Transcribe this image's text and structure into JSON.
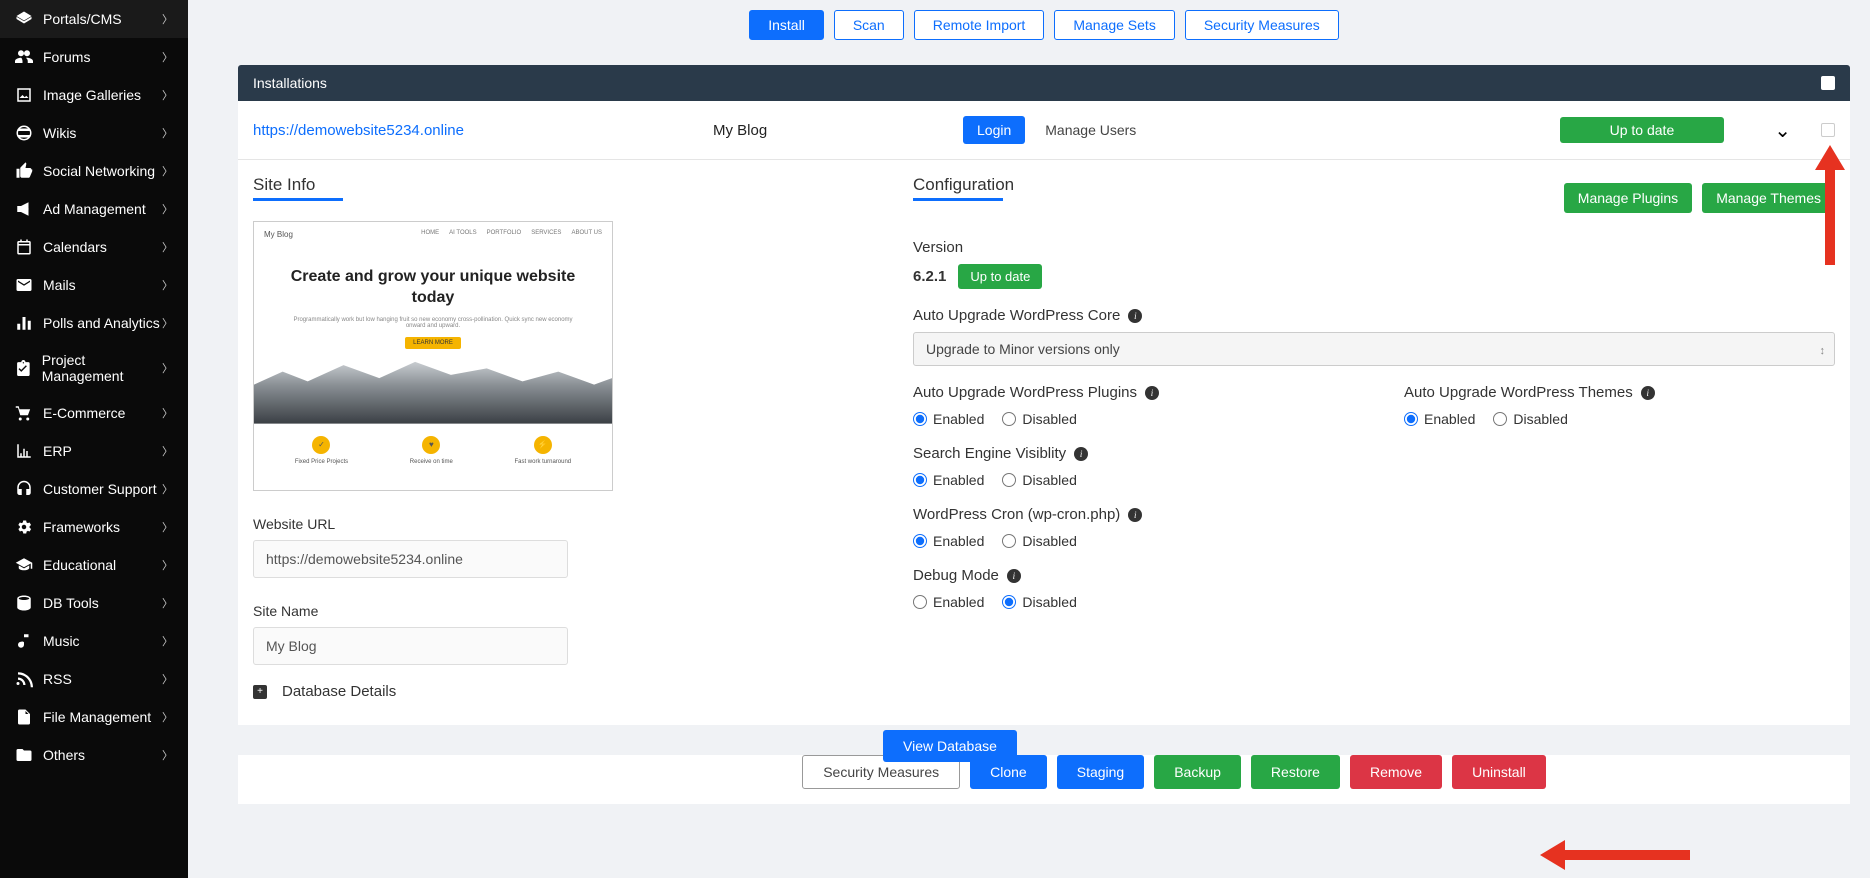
{
  "sidebar": {
    "items": [
      {
        "label": "Portals/CMS",
        "icon": "portals"
      },
      {
        "label": "Forums",
        "icon": "forums"
      },
      {
        "label": "Image Galleries",
        "icon": "galleries"
      },
      {
        "label": "Wikis",
        "icon": "wikis"
      },
      {
        "label": "Social Networking",
        "icon": "social"
      },
      {
        "label": "Ad Management",
        "icon": "ads"
      },
      {
        "label": "Calendars",
        "icon": "calendars"
      },
      {
        "label": "Mails",
        "icon": "mails"
      },
      {
        "label": "Polls and Analytics",
        "icon": "polls"
      },
      {
        "label": "Project Management",
        "icon": "project"
      },
      {
        "label": "E-Commerce",
        "icon": "ecommerce"
      },
      {
        "label": "ERP",
        "icon": "erp"
      },
      {
        "label": "Customer Support",
        "icon": "support"
      },
      {
        "label": "Frameworks",
        "icon": "frameworks"
      },
      {
        "label": "Educational",
        "icon": "educational"
      },
      {
        "label": "DB Tools",
        "icon": "dbtools"
      },
      {
        "label": "Music",
        "icon": "music"
      },
      {
        "label": "RSS",
        "icon": "rss"
      },
      {
        "label": "File Management",
        "icon": "filemgmt"
      },
      {
        "label": "Others",
        "icon": "others"
      }
    ]
  },
  "tabs": [
    {
      "label": "Install",
      "active": true
    },
    {
      "label": "Scan"
    },
    {
      "label": "Remote Import"
    },
    {
      "label": "Manage Sets"
    },
    {
      "label": "Security Measures"
    }
  ],
  "installations": {
    "header": "Installations",
    "row": {
      "url": "https://demowebsite5234.online",
      "name": "My Blog",
      "login": "Login",
      "manage_users": "Manage Users",
      "status": "Up to date"
    }
  },
  "site_info": {
    "title": "Site Info",
    "preview": {
      "blog_title": "My Blog",
      "nav": [
        "HOME",
        "AI TOOLS",
        "PORTFOLIO",
        "SERVICES",
        "ABOUT US"
      ],
      "hero_title": "Create and grow your unique website today",
      "hero_sub": "Programmatically work but low hanging fruit so new economy cross-pollination. Quick sync new economy onward and upward.",
      "cta": "LEARN MORE",
      "features": [
        "Fixed Price Projects",
        "Receive on time",
        "Fast work turnaround"
      ]
    },
    "website_url_label": "Website URL",
    "website_url_value": "https://demowebsite5234.online",
    "site_name_label": "Site Name",
    "site_name_value": "My Blog",
    "db_details": "Database Details",
    "view_db": "View Database"
  },
  "config": {
    "title": "Configuration",
    "manage_plugins": "Manage Plugins",
    "manage_themes": "Manage Themes",
    "version_label": "Version",
    "version_value": "6.2.1",
    "version_badge": "Up to date",
    "upgrade_core_label": "Auto Upgrade WordPress Core",
    "upgrade_core_value": "Upgrade to Minor versions only",
    "upgrade_plugins_label": "Auto Upgrade WordPress Plugins",
    "upgrade_themes_label": "Auto Upgrade WordPress Themes",
    "search_label": "Search Engine Visiblity",
    "cron_label": "WordPress Cron (wp-cron.php)",
    "debug_label": "Debug Mode",
    "enabled": "Enabled",
    "disabled": "Disabled"
  },
  "actions": {
    "security": "Security Measures",
    "clone": "Clone",
    "staging": "Staging",
    "backup": "Backup",
    "restore": "Restore",
    "remove": "Remove",
    "uninstall": "Uninstall"
  }
}
